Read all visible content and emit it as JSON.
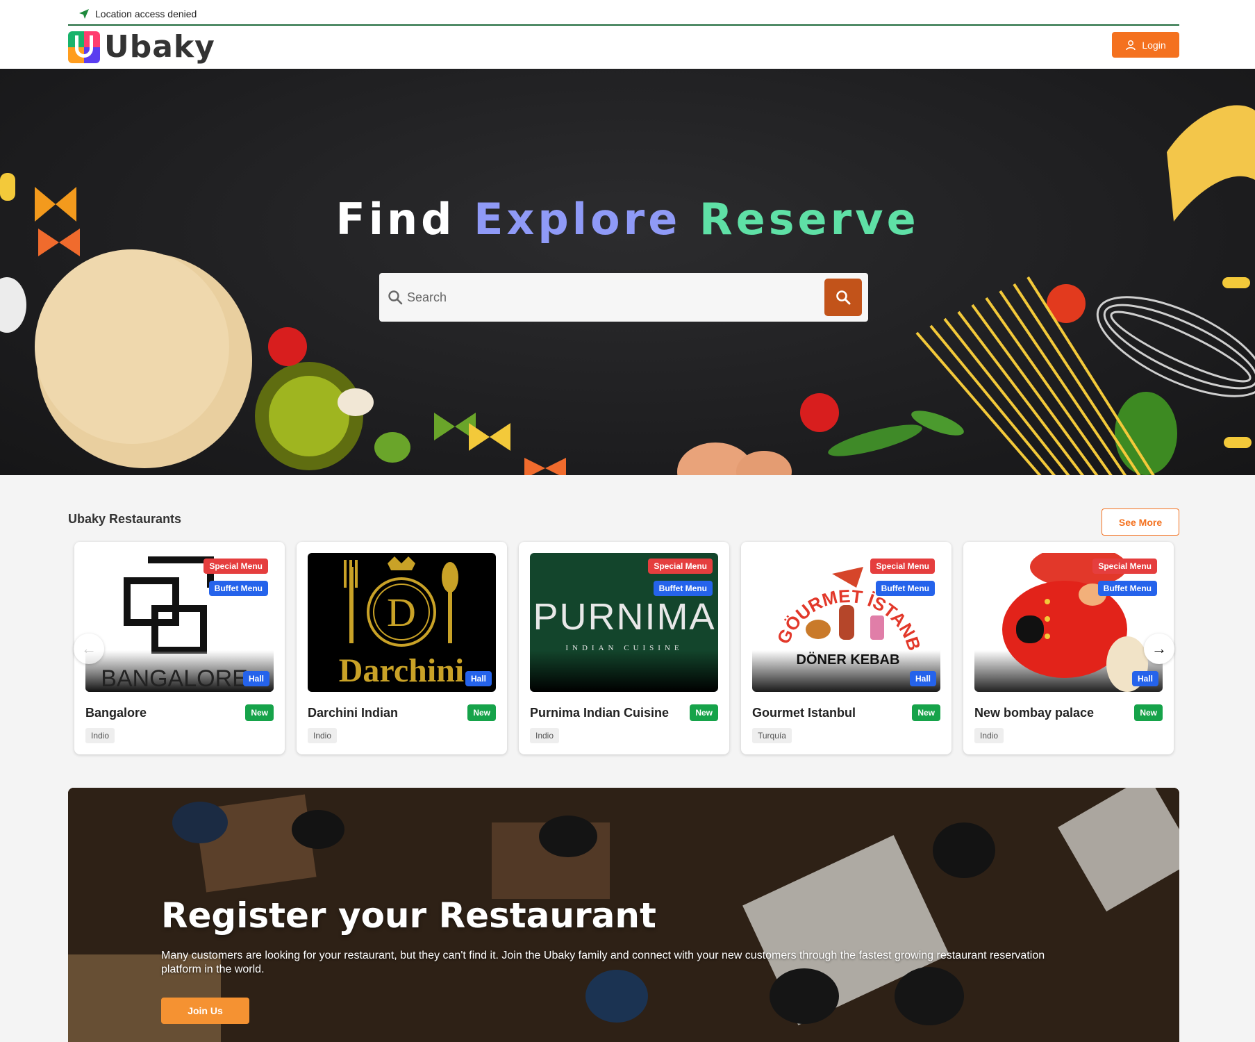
{
  "location_status": "Location access denied",
  "brand": {
    "name": "Ubaky"
  },
  "header": {
    "login_label": "Login"
  },
  "hero": {
    "title_words": [
      "Find",
      "Explore",
      "Reserve"
    ],
    "search_placeholder": "Search"
  },
  "restaurants": {
    "section_title": "Ubaky Restaurants",
    "see_more_label": "See More",
    "badges": {
      "special": "Special Menu",
      "buffet": "Buffet Menu",
      "hall": "Hall",
      "new": "New"
    },
    "items": [
      {
        "name": "Bangalore",
        "cuisine": "Indio",
        "image_text": "BANGALORE",
        "special_menu": true,
        "buffet_menu": true
      },
      {
        "name": "Darchini Indian",
        "cuisine": "Indio",
        "image_text": "Darchini",
        "monogram": "D",
        "special_menu": false,
        "buffet_menu": false
      },
      {
        "name": "Purnima Indian Cuisine",
        "cuisine": "Indio",
        "image_text": "PURNIMA",
        "image_subtext": "INDIAN CUISINE",
        "special_menu": true,
        "buffet_menu": true
      },
      {
        "name": "Gourmet Istanbul",
        "cuisine": "Turquía",
        "image_text": "DÖNER KEBAB",
        "image_arc_text": "GÖURMET İSTANBUL",
        "special_menu": true,
        "buffet_menu": true
      },
      {
        "name": "New bombay palace",
        "cuisine": "Indio",
        "special_menu": true,
        "buffet_menu": true
      }
    ]
  },
  "register": {
    "title": "Register your Restaurant",
    "description": "Many customers are looking for your restaurant, but they can't find it. Join the Ubaky family and connect with your new customers through the fastest growing restaurant reservation platform in the world.",
    "cta_label": "Join Us"
  },
  "colors": {
    "accent": "#f4711f",
    "explore": "#8f9af7",
    "reserve": "#5fe0a6",
    "special_badge": "#e53e3e",
    "buffet_badge": "#2563eb",
    "new_badge": "#16a34a"
  }
}
